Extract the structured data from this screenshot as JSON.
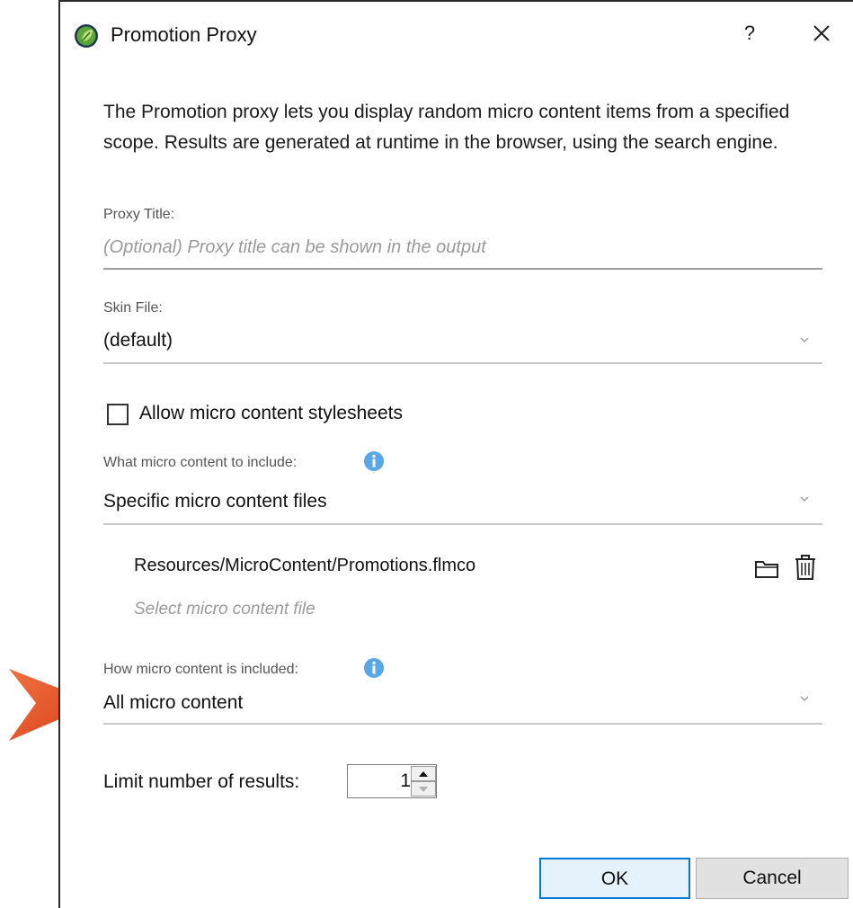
{
  "dialog": {
    "title": "Promotion Proxy",
    "help_label": "?",
    "description": "The Promotion proxy lets you display random micro content items from a specified scope. Results are generated at runtime in the browser, using the search engine."
  },
  "proxy_title": {
    "label": "Proxy Title:",
    "placeholder": "(Optional) Proxy title can be shown in the output",
    "value": ""
  },
  "skin_file": {
    "label": "Skin File:",
    "value": "(default)"
  },
  "allow_stylesheets": {
    "label": "Allow micro content stylesheets",
    "checked": false
  },
  "what_to_include": {
    "label": "What micro content to include:",
    "value": "Specific micro content files"
  },
  "files": {
    "items": [
      "Resources/MicroContent/Promotions.flmco"
    ],
    "select_placeholder": "Select micro content file"
  },
  "how_included": {
    "label": "How micro content is included:",
    "value": "All micro content"
  },
  "limit": {
    "label": "Limit number of results:",
    "value": "1"
  },
  "buttons": {
    "ok": "OK",
    "cancel": "Cancel"
  },
  "colors": {
    "accent": "#0078d7",
    "info_icon": "#5aa7e8",
    "callout_arrow": "#e8542a",
    "app_icon_green": "#5aa43a"
  },
  "icons": [
    "app-logo-icon",
    "close-icon",
    "chevron-down-icon",
    "info-icon",
    "folder-icon",
    "trash-icon",
    "spin-up-icon",
    "spin-down-icon",
    "callout-arrow-icon"
  ]
}
